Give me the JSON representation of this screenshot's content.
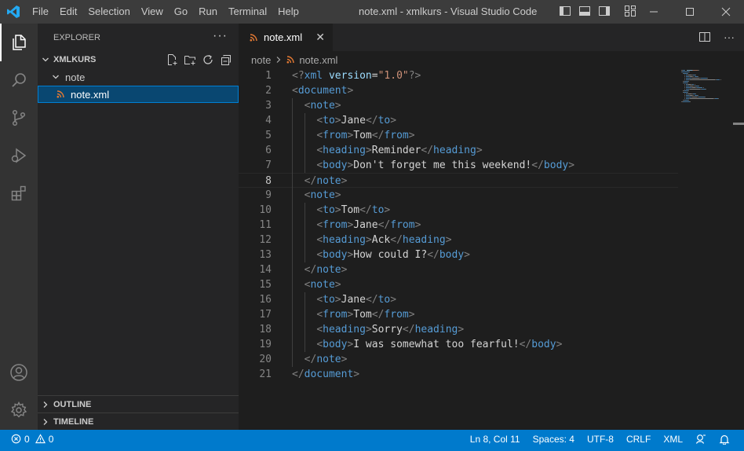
{
  "titlebar": {
    "menus": [
      "File",
      "Edit",
      "Selection",
      "View",
      "Go",
      "Run",
      "Terminal",
      "Help"
    ],
    "title": "note.xml - xmlkurs - Visual Studio Code"
  },
  "sidebar": {
    "header": "EXPLORER",
    "more": "···",
    "folder": "XMLKURS",
    "tree": [
      {
        "label": "note",
        "type": "folder"
      },
      {
        "label": "note.xml",
        "type": "file"
      }
    ],
    "outline": "OUTLINE",
    "timeline": "TIMELINE"
  },
  "editor": {
    "tab_label": "note.xml",
    "tab_close": "✕",
    "breadcrumb": [
      "note",
      "note.xml"
    ],
    "current_line": 8,
    "lines": [
      [
        [
          "b",
          "<?"
        ],
        [
          "t",
          "xml"
        ],
        [
          "x",
          " "
        ],
        [
          "a",
          "version"
        ],
        [
          "x",
          "="
        ],
        [
          "s",
          "\"1.0\""
        ],
        [
          "b",
          "?>"
        ]
      ],
      [
        [
          "b",
          "<"
        ],
        [
          "t",
          "document"
        ],
        [
          "b",
          ">"
        ]
      ],
      [
        [
          "x",
          "  "
        ],
        [
          "b",
          "<"
        ],
        [
          "t",
          "note"
        ],
        [
          "b",
          ">"
        ]
      ],
      [
        [
          "x",
          "    "
        ],
        [
          "b",
          "<"
        ],
        [
          "t",
          "to"
        ],
        [
          "b",
          ">"
        ],
        [
          "x",
          "Jane"
        ],
        [
          "b",
          "</"
        ],
        [
          "t",
          "to"
        ],
        [
          "b",
          ">"
        ]
      ],
      [
        [
          "x",
          "    "
        ],
        [
          "b",
          "<"
        ],
        [
          "t",
          "from"
        ],
        [
          "b",
          ">"
        ],
        [
          "x",
          "Tom"
        ],
        [
          "b",
          "</"
        ],
        [
          "t",
          "from"
        ],
        [
          "b",
          ">"
        ]
      ],
      [
        [
          "x",
          "    "
        ],
        [
          "b",
          "<"
        ],
        [
          "t",
          "heading"
        ],
        [
          "b",
          ">"
        ],
        [
          "x",
          "Reminder"
        ],
        [
          "b",
          "</"
        ],
        [
          "t",
          "heading"
        ],
        [
          "b",
          ">"
        ]
      ],
      [
        [
          "x",
          "    "
        ],
        [
          "b",
          "<"
        ],
        [
          "t",
          "body"
        ],
        [
          "b",
          ">"
        ],
        [
          "x",
          "Don't forget me this weekend!"
        ],
        [
          "b",
          "</"
        ],
        [
          "t",
          "body"
        ],
        [
          "b",
          ">"
        ]
      ],
      [
        [
          "x",
          "  "
        ],
        [
          "b",
          "</"
        ],
        [
          "t",
          "note"
        ],
        [
          "b",
          ">"
        ]
      ],
      [
        [
          "x",
          "  "
        ],
        [
          "b",
          "<"
        ],
        [
          "t",
          "note"
        ],
        [
          "b",
          ">"
        ]
      ],
      [
        [
          "x",
          "    "
        ],
        [
          "b",
          "<"
        ],
        [
          "t",
          "to"
        ],
        [
          "b",
          ">"
        ],
        [
          "x",
          "Tom"
        ],
        [
          "b",
          "</"
        ],
        [
          "t",
          "to"
        ],
        [
          "b",
          ">"
        ]
      ],
      [
        [
          "x",
          "    "
        ],
        [
          "b",
          "<"
        ],
        [
          "t",
          "from"
        ],
        [
          "b",
          ">"
        ],
        [
          "x",
          "Jane"
        ],
        [
          "b",
          "</"
        ],
        [
          "t",
          "from"
        ],
        [
          "b",
          ">"
        ]
      ],
      [
        [
          "x",
          "    "
        ],
        [
          "b",
          "<"
        ],
        [
          "t",
          "heading"
        ],
        [
          "b",
          ">"
        ],
        [
          "x",
          "Ack"
        ],
        [
          "b",
          "</"
        ],
        [
          "t",
          "heading"
        ],
        [
          "b",
          ">"
        ]
      ],
      [
        [
          "x",
          "    "
        ],
        [
          "b",
          "<"
        ],
        [
          "t",
          "body"
        ],
        [
          "b",
          ">"
        ],
        [
          "x",
          "How could I?"
        ],
        [
          "b",
          "</"
        ],
        [
          "t",
          "body"
        ],
        [
          "b",
          ">"
        ]
      ],
      [
        [
          "x",
          "  "
        ],
        [
          "b",
          "</"
        ],
        [
          "t",
          "note"
        ],
        [
          "b",
          ">"
        ]
      ],
      [
        [
          "x",
          "  "
        ],
        [
          "b",
          "<"
        ],
        [
          "t",
          "note"
        ],
        [
          "b",
          ">"
        ]
      ],
      [
        [
          "x",
          "    "
        ],
        [
          "b",
          "<"
        ],
        [
          "t",
          "to"
        ],
        [
          "b",
          ">"
        ],
        [
          "x",
          "Jane"
        ],
        [
          "b",
          "</"
        ],
        [
          "t",
          "to"
        ],
        [
          "b",
          ">"
        ]
      ],
      [
        [
          "x",
          "    "
        ],
        [
          "b",
          "<"
        ],
        [
          "t",
          "from"
        ],
        [
          "b",
          ">"
        ],
        [
          "x",
          "Tom"
        ],
        [
          "b",
          "</"
        ],
        [
          "t",
          "from"
        ],
        [
          "b",
          ">"
        ]
      ],
      [
        [
          "x",
          "    "
        ],
        [
          "b",
          "<"
        ],
        [
          "t",
          "heading"
        ],
        [
          "b",
          ">"
        ],
        [
          "x",
          "Sorry"
        ],
        [
          "b",
          "</"
        ],
        [
          "t",
          "heading"
        ],
        [
          "b",
          ">"
        ]
      ],
      [
        [
          "x",
          "    "
        ],
        [
          "b",
          "<"
        ],
        [
          "t",
          "body"
        ],
        [
          "b",
          ">"
        ],
        [
          "x",
          "I was somewhat too fearful!"
        ],
        [
          "b",
          "</"
        ],
        [
          "t",
          "body"
        ],
        [
          "b",
          ">"
        ]
      ],
      [
        [
          "x",
          "  "
        ],
        [
          "b",
          "</"
        ],
        [
          "t",
          "note"
        ],
        [
          "b",
          ">"
        ]
      ],
      [
        [
          "b",
          "</"
        ],
        [
          "t",
          "document"
        ],
        [
          "b",
          ">"
        ]
      ]
    ]
  },
  "statusbar": {
    "errors": "0",
    "warnings": "0",
    "position": "Ln 8, Col 11",
    "spaces": "Spaces: 4",
    "encoding": "UTF-8",
    "eol": "CRLF",
    "language": "XML"
  },
  "colors": {
    "accent": "#007acc",
    "tag": "#569cd6",
    "bracket": "#808080",
    "attribute": "#9cdcfe",
    "string": "#ce9178",
    "rss_icon": "#e37933"
  }
}
